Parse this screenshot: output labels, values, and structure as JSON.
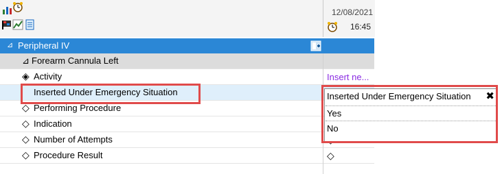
{
  "header": {
    "date": "12/08/2021",
    "time": "16:45"
  },
  "group": {
    "title": "Peripheral IV",
    "collapse_glyph": "⊿"
  },
  "subgroup": {
    "title": "Forearm Cannula Left"
  },
  "rows": [
    {
      "label": "Activity",
      "value": "Insert ne..."
    },
    {
      "label": "Inserted Under Emergency Situation",
      "value": ""
    },
    {
      "label": "Performing Procedure",
      "value": ""
    },
    {
      "label": "Indication",
      "value": ""
    },
    {
      "label": "Number of Attempts",
      "value": ""
    },
    {
      "label": "Procedure Result",
      "value": ""
    }
  ],
  "dropdown": {
    "title": "Inserted Under Emergency Situation",
    "close_glyph": "✖",
    "options": [
      "Yes",
      "No"
    ]
  },
  "colors": {
    "header_blue": "#2b87d6",
    "highlight_red": "#e04a4a",
    "activity_value": "#8a2be2"
  },
  "icons": [
    "chart-icon",
    "alarm-clock-icon",
    "flag-icon",
    "graph-icon",
    "document-icon",
    "add-column-icon",
    "diamond-icon"
  ]
}
